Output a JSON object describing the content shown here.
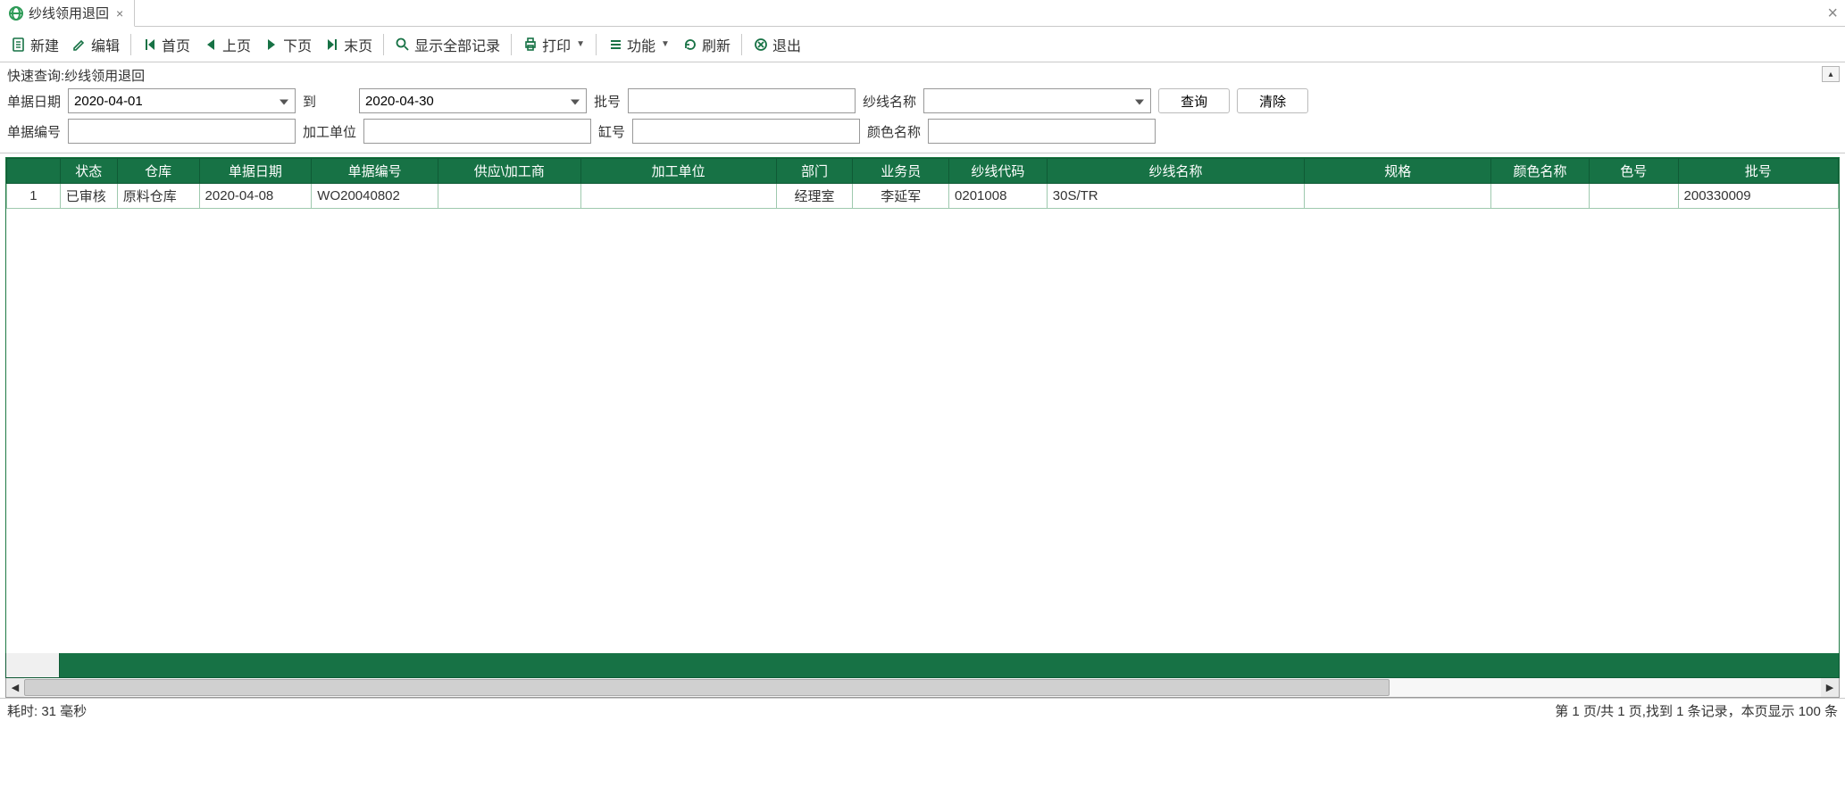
{
  "tab": {
    "title": "纱线领用退回"
  },
  "toolbar": {
    "new_label": "新建",
    "edit_label": "编辑",
    "first_label": "首页",
    "prev_label": "上页",
    "next_label": "下页",
    "last_label": "末页",
    "showall_label": "显示全部记录",
    "print_label": "打印",
    "func_label": "功能",
    "refresh_label": "刷新",
    "exit_label": "退出"
  },
  "query": {
    "title": "快速查询:纱线领用退回",
    "date_label": "单据日期",
    "date_from": "2020-04-01",
    "to_label": "到",
    "date_to": "2020-04-30",
    "batch_label": "批号",
    "batch_value": "",
    "yarnname_label": "纱线名称",
    "yarnname_value": "",
    "search_btn": "查询",
    "clear_btn": "清除",
    "docno_label": "单据编号",
    "docno_value": "",
    "procunit_label": "加工单位",
    "procunit_value": "",
    "vatno_label": "缸号",
    "vatno_value": "",
    "colorname_label": "颜色名称",
    "colorname_value": ""
  },
  "grid": {
    "columns": [
      "状态",
      "仓库",
      "单据日期",
      "单据编号",
      "供应\\加工商",
      "加工单位",
      "部门",
      "业务员",
      "纱线代码",
      "纱线名称",
      "规格",
      "颜色名称",
      "色号",
      "批号"
    ],
    "rows": [
      {
        "rownum": "1",
        "status": "已审核",
        "warehouse": "原料仓库",
        "docdate": "2020-04-08",
        "docno": "WO20040802",
        "supplier": "",
        "procunit": "",
        "dept": "经理室",
        "salesman": "李延军",
        "yarncode": "0201008",
        "yarnname": "30S/TR",
        "spec": "",
        "colorname": "",
        "colorno": "",
        "batch": "200330009"
      }
    ]
  },
  "status": {
    "left": "耗时: 31 毫秒",
    "right": "第 1 页/共 1 页,找到 1 条记录，本页显示 100 条"
  },
  "colors": {
    "accent": "#177245",
    "accent_light": "#2e9b57"
  }
}
